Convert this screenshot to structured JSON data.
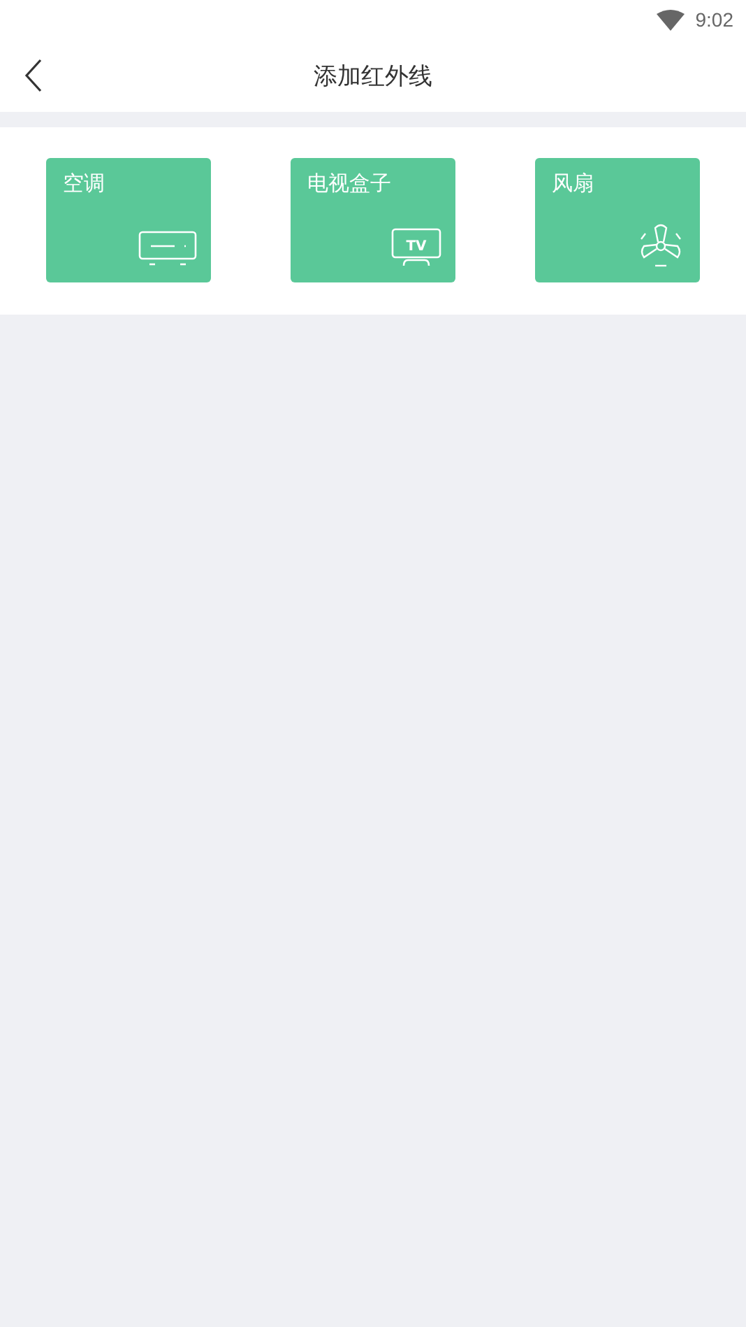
{
  "status_bar": {
    "time": "9:02"
  },
  "header": {
    "title": "添加红外线"
  },
  "devices": [
    {
      "label": "空调",
      "kind": "ac"
    },
    {
      "label": "电视盒子",
      "kind": "tv",
      "icon_text": "TV"
    },
    {
      "label": "风扇",
      "kind": "fan"
    }
  ]
}
